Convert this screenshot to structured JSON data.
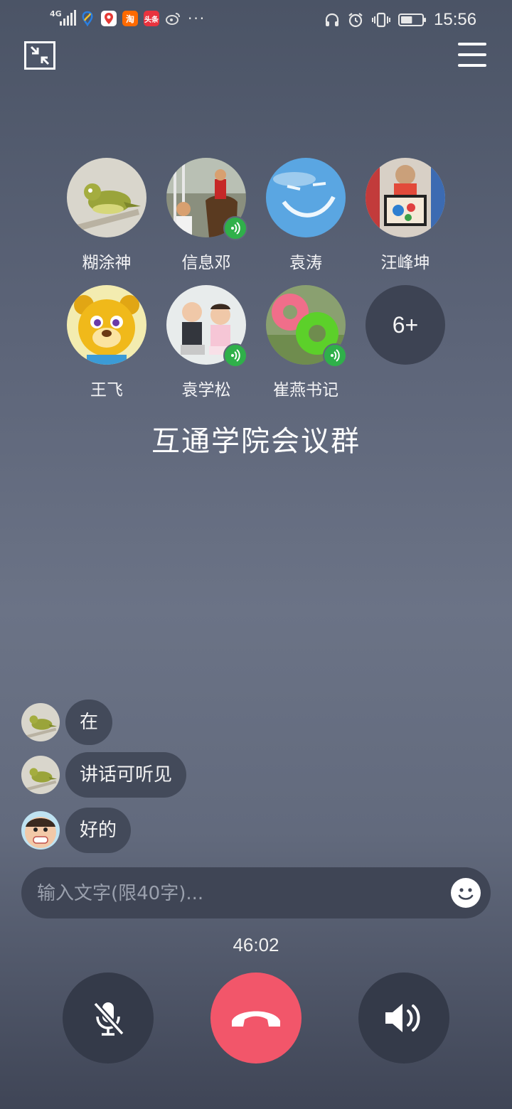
{
  "status_bar": {
    "network": "4G",
    "app_icons": [
      "location-app",
      "map-app",
      "taobao-app",
      "news-app",
      "weibo-app"
    ],
    "taobao_label": "淘",
    "news_label": "头条",
    "overflow": "···",
    "time": "15:56",
    "battery_level": 0.55
  },
  "participants": [
    {
      "name": "糊涂神",
      "speaking": false,
      "avatar": "bird"
    },
    {
      "name": "信息邓",
      "speaking": true,
      "avatar": "horse-guard"
    },
    {
      "name": "袁涛",
      "speaking": false,
      "avatar": "sky-smile"
    },
    {
      "name": "汪峰坤",
      "speaking": false,
      "avatar": "child-painting"
    },
    {
      "name": "王飞",
      "speaking": false,
      "avatar": "cartoon-bear"
    },
    {
      "name": "袁学松",
      "speaking": true,
      "avatar": "two-babies"
    },
    {
      "name": "崔燕书记",
      "speaking": true,
      "avatar": "swim-rings"
    }
  ],
  "more_count": "6+",
  "group_name": "互通学院会议群",
  "messages": [
    {
      "text": "在",
      "avatar": "bird"
    },
    {
      "text": "讲话可听见",
      "avatar": "bird"
    },
    {
      "text": "好的",
      "avatar": "child-face"
    }
  ],
  "input": {
    "placeholder": "输入文字(限40字)...",
    "value": ""
  },
  "timer": "46:02",
  "colors": {
    "hangup": "#f2566a",
    "speaking_badge": "#2fb04a",
    "control_bg": "#343a49"
  }
}
